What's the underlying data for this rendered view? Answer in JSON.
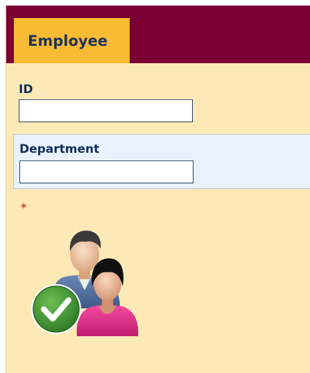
{
  "tab": {
    "label": "Employee"
  },
  "fields": {
    "id": {
      "label": "ID",
      "value": "",
      "placeholder": ""
    },
    "department": {
      "label": "Department",
      "value": "",
      "placeholder": ""
    }
  },
  "required_marker": "*",
  "icons": {
    "users": "users-check-icon"
  },
  "colors": {
    "header": "#7b0033",
    "tab": "#f9bb33",
    "panel": "#fde9b6",
    "highlight_row": "#e9f2fc",
    "label_text": "#13305a",
    "required": "#e0392b"
  }
}
